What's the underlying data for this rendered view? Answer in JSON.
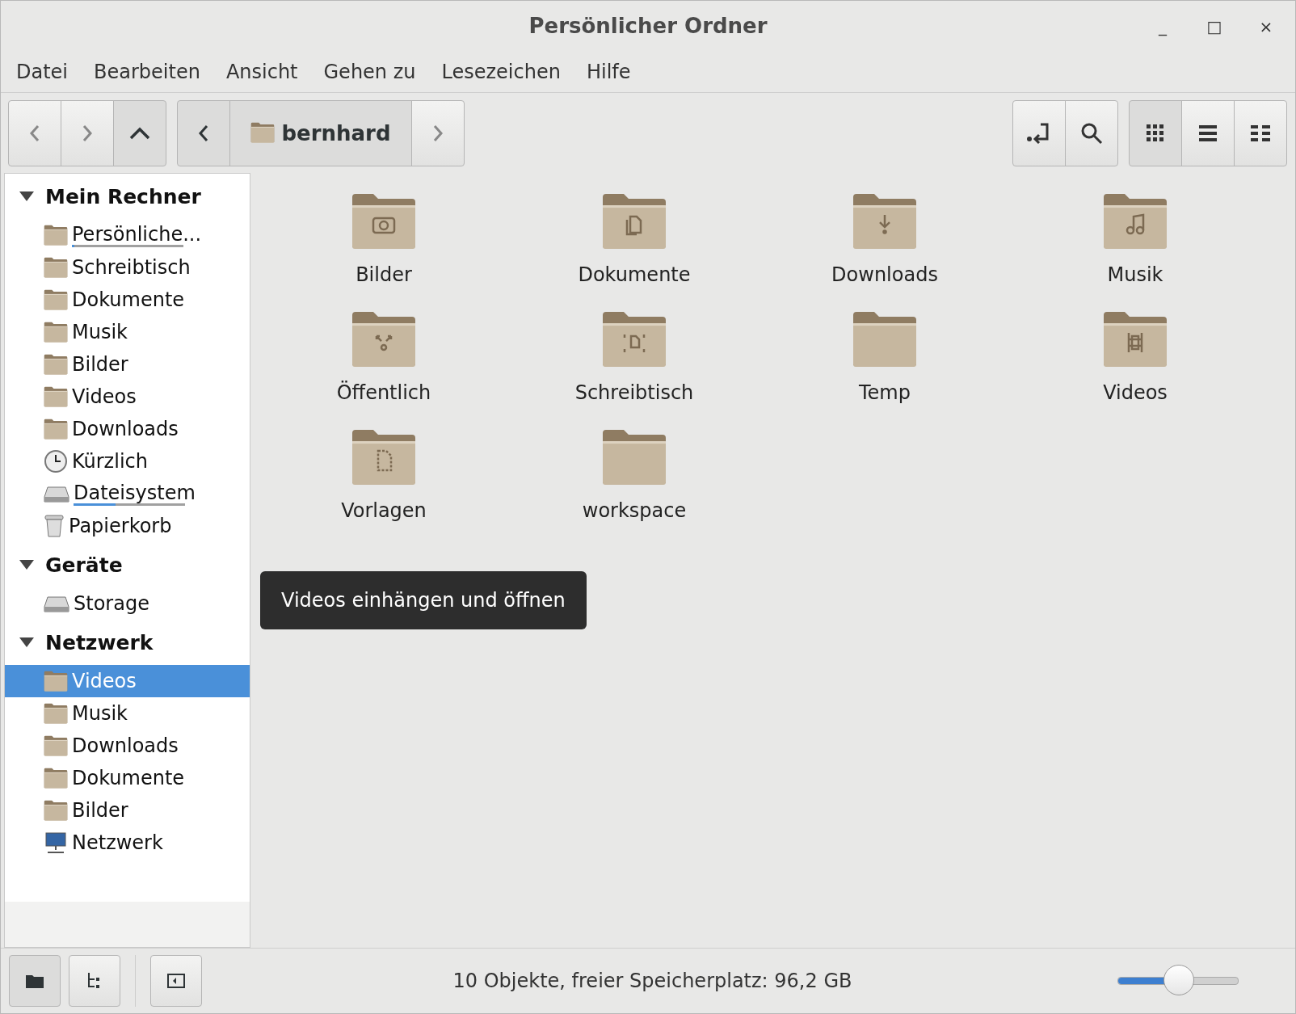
{
  "window": {
    "title": "Persönlicher Ordner",
    "controls": [
      "_",
      "□",
      "×"
    ]
  },
  "menu": [
    "Datei",
    "Bearbeiten",
    "Ansicht",
    "Gehen zu",
    "Lesezeichen",
    "Hilfe"
  ],
  "toolbar": {
    "path": "bernhard",
    "view_modes": [
      {
        "kind": "icons",
        "selected": true
      },
      {
        "kind": "list",
        "selected": false
      },
      {
        "kind": "compact",
        "selected": false
      }
    ]
  },
  "sidebar": [
    {
      "title": "Mein Rechner",
      "expanded": true,
      "items": [
        {
          "label": "Persönliche...",
          "kind": "home",
          "selected": false,
          "level": 0.02
        },
        {
          "label": "Schreibtisch",
          "kind": "desktop",
          "selected": false
        },
        {
          "label": "Dokumente",
          "kind": "documents",
          "selected": false
        },
        {
          "label": "Musik",
          "kind": "music",
          "selected": false
        },
        {
          "label": "Bilder",
          "kind": "pictures",
          "selected": false
        },
        {
          "label": "Videos",
          "kind": "videos",
          "selected": false
        },
        {
          "label": "Downloads",
          "kind": "downloads",
          "selected": false
        },
        {
          "label": "Kürzlich",
          "kind": "recent",
          "selected": false
        },
        {
          "label": "Dateisystem",
          "kind": "drive",
          "selected": false,
          "level": 0.38
        },
        {
          "label": "Papierkorb",
          "kind": "trash",
          "selected": false
        }
      ]
    },
    {
      "title": "Geräte",
      "expanded": true,
      "items": [
        {
          "label": "Storage",
          "kind": "drive",
          "selected": false
        }
      ]
    },
    {
      "title": "Netzwerk",
      "expanded": true,
      "items": [
        {
          "label": "Videos",
          "kind": "share",
          "selected": true
        },
        {
          "label": "Musik",
          "kind": "share",
          "selected": false
        },
        {
          "label": "Downloads",
          "kind": "share",
          "selected": false
        },
        {
          "label": "Dokumente",
          "kind": "share",
          "selected": false
        },
        {
          "label": "Bilder",
          "kind": "share",
          "selected": false
        },
        {
          "label": "Netzwerk",
          "kind": "network",
          "selected": false
        }
      ]
    }
  ],
  "files": [
    {
      "name": "Bilder",
      "kind": "pictures"
    },
    {
      "name": "Dokumente",
      "kind": "documents"
    },
    {
      "name": "Downloads",
      "kind": "downloads"
    },
    {
      "name": "Musik",
      "kind": "music"
    },
    {
      "name": "Öffentlich",
      "kind": "public"
    },
    {
      "name": "Schreibtisch",
      "kind": "desktop"
    },
    {
      "name": "Temp",
      "kind": "plain"
    },
    {
      "name": "Videos",
      "kind": "videos"
    },
    {
      "name": "Vorlagen",
      "kind": "templates"
    },
    {
      "name": "workspace",
      "kind": "plain"
    }
  ],
  "tooltip": "Videos einhängen und öffnen",
  "status_bar": {
    "text": "10 Objekte, freier Speicherplatz: 96,2 GB",
    "zoom": {
      "level": 0.5
    }
  }
}
